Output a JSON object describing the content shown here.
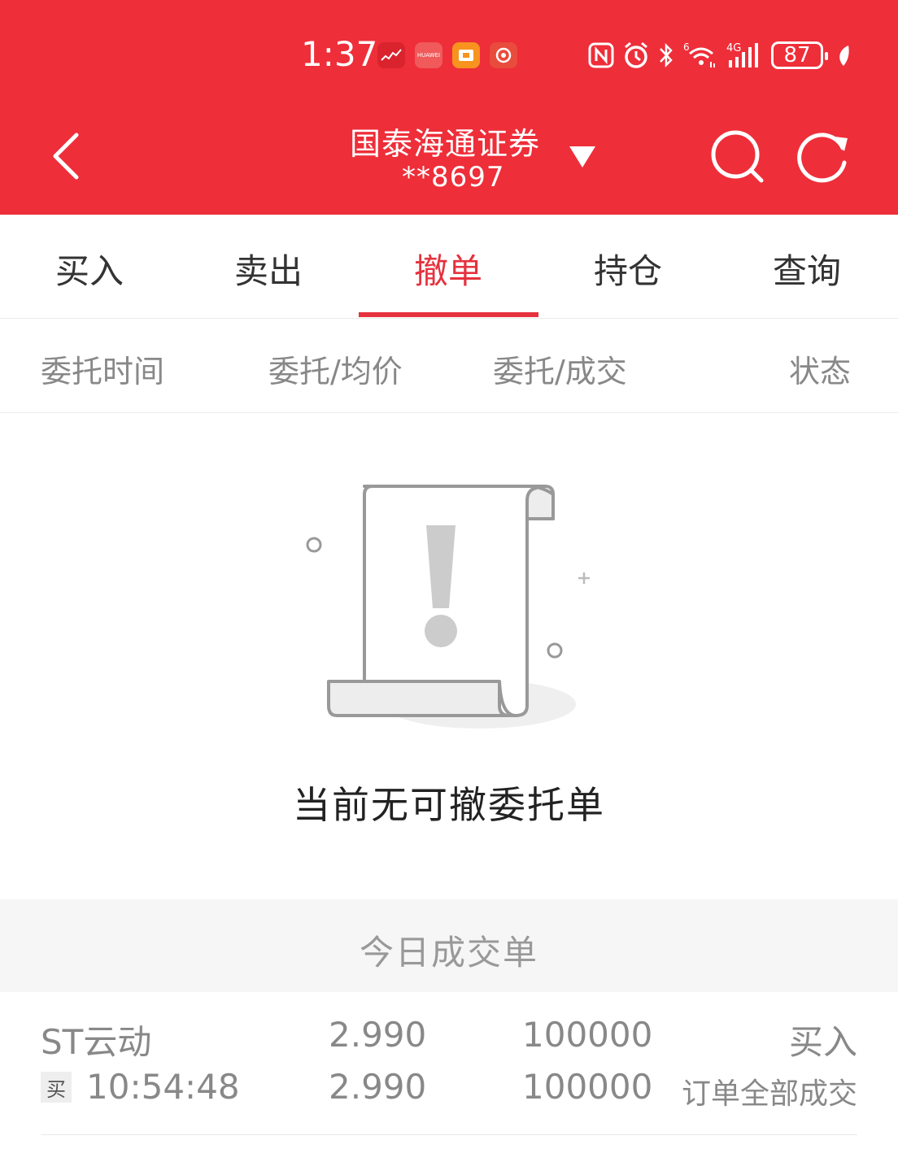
{
  "status_bar": {
    "time": "1:37",
    "battery": "87",
    "icons": [
      "app-stock-icon",
      "huawei-icon",
      "app-card-icon",
      "app-circle-icon",
      "nfc-icon",
      "alarm-icon",
      "bluetooth-icon",
      "wifi-icon",
      "signal-4g-icon",
      "battery-icon",
      "leaf-icon"
    ],
    "huawei_label": "HUAWEI"
  },
  "header": {
    "title": "国泰海通证券",
    "account": "**8697",
    "bg_color": "#ee2e39"
  },
  "tabs": [
    {
      "label": "买入",
      "active": false
    },
    {
      "label": "卖出",
      "active": false
    },
    {
      "label": "撤单",
      "active": true
    },
    {
      "label": "持仓",
      "active": false
    },
    {
      "label": "查询",
      "active": false
    }
  ],
  "columns": [
    "委托时间",
    "委托/均价",
    "委托/成交",
    "状态"
  ],
  "empty_state": {
    "message": "当前无可撤委托单",
    "icon": "empty-scroll-icon"
  },
  "today_trades": {
    "title": "今日成交单",
    "rows": [
      {
        "name": "ST云动",
        "side_tag": "买",
        "time": "10:54:48",
        "order_price": "2.990",
        "avg_price": "2.990",
        "order_qty": "100000",
        "filled_qty": "100000",
        "direction": "买入",
        "status": "订单全部成交"
      }
    ]
  },
  "colors": {
    "accent": "#e5323e",
    "header_bg": "#ee2e39"
  }
}
